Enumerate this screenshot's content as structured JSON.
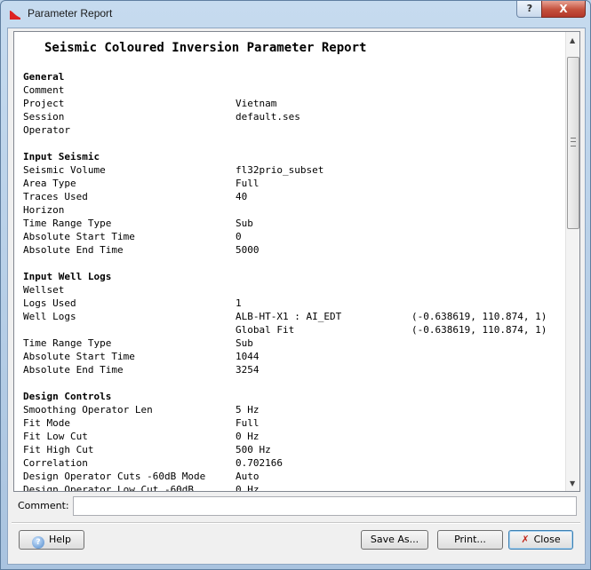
{
  "window": {
    "title": "Parameter Report",
    "help_glyph": "?",
    "close_glyph": "X"
  },
  "report": {
    "title": "Seismic Coloured Inversion Parameter Report",
    "rows": [
      {
        "key": "General",
        "section": true
      },
      {
        "key": "Comment",
        "value": ""
      },
      {
        "key": "Project",
        "value": "Vietnam"
      },
      {
        "key": "Session",
        "value": "default.ses"
      },
      {
        "key": "Operator",
        "value": ""
      },
      {
        "key": "",
        "value": ""
      },
      {
        "key": "Input Seismic",
        "section": true
      },
      {
        "key": "Seismic Volume",
        "value": "fl32prio_subset"
      },
      {
        "key": "Area Type",
        "value": "Full"
      },
      {
        "key": "Traces Used",
        "value": "40"
      },
      {
        "key": "Horizon",
        "value": ""
      },
      {
        "key": "Time Range Type",
        "value": "Sub"
      },
      {
        "key": "Absolute Start Time",
        "value": "0"
      },
      {
        "key": "Absolute End Time",
        "value": "5000"
      },
      {
        "key": "",
        "value": ""
      },
      {
        "key": "Input Well Logs",
        "section": true
      },
      {
        "key": "Wellset",
        "value": ""
      },
      {
        "key": "Logs Used",
        "value": "1"
      },
      {
        "key": "Well Logs",
        "value": "ALB-HT-X1 : AI_EDT",
        "value2": "(-0.638619, 110.874, 1)"
      },
      {
        "key": "",
        "value": "Global Fit",
        "value2": "(-0.638619, 110.874, 1)"
      },
      {
        "key": "Time Range Type",
        "value": "Sub"
      },
      {
        "key": "Absolute Start Time",
        "value": "1044"
      },
      {
        "key": "Absolute End Time",
        "value": "3254"
      },
      {
        "key": "",
        "value": ""
      },
      {
        "key": "Design Controls",
        "section": true
      },
      {
        "key": "Smoothing Operator Len",
        "value": "5 Hz"
      },
      {
        "key": "Fit Mode",
        "value": "Full"
      },
      {
        "key": "Fit Low Cut",
        "value": "0 Hz"
      },
      {
        "key": "Fit High Cut",
        "value": "500 Hz"
      },
      {
        "key": "Correlation",
        "value": "0.702166"
      },
      {
        "key": "Design Operator Cuts -60dB Mode",
        "value": "Auto"
      },
      {
        "key": "Design Operator Low Cut -60dB",
        "value": "0 Hz"
      }
    ]
  },
  "comment": {
    "label": "Comment:",
    "value": ""
  },
  "buttons": {
    "help": "Help",
    "save_as": "Save As...",
    "print": "Print...",
    "close": "Close"
  },
  "icons": {
    "help_icon_glyph": "?",
    "close_icon_glyph": "✗"
  }
}
